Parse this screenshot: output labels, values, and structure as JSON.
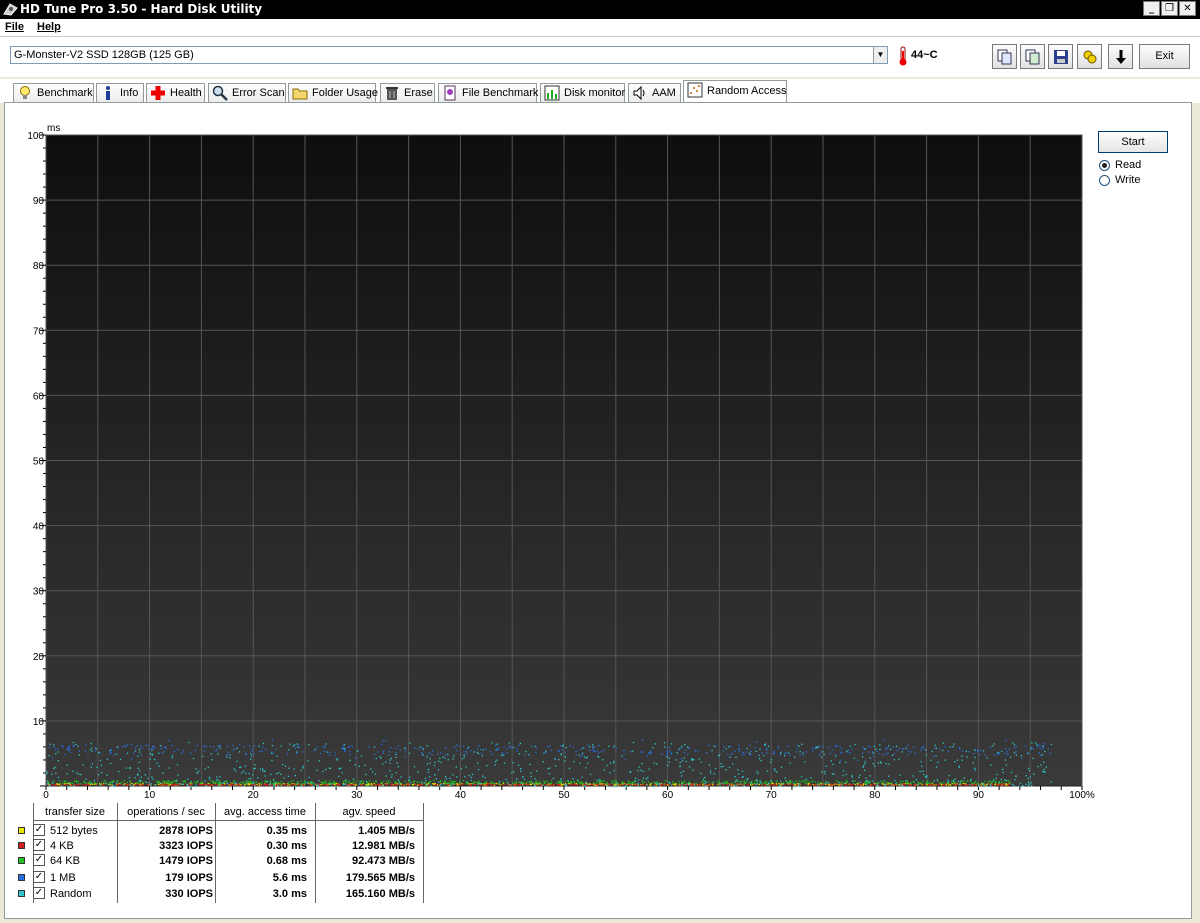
{
  "window": {
    "title": "HD Tune Pro 3.50 - Hard Disk Utility"
  },
  "menu": {
    "file": "File",
    "help": "Help"
  },
  "toolbar": {
    "drive": "G-Monster-V2 SSD 128GB (125 GB)",
    "temperature": "44~C",
    "exit_label": "Exit"
  },
  "tabs": [
    {
      "label": "Benchmark",
      "icon": "lightbulb-icon"
    },
    {
      "label": "Info",
      "icon": "info-icon"
    },
    {
      "label": "Health",
      "icon": "health-cross-icon"
    },
    {
      "label": "Error Scan",
      "icon": "magnifier-icon"
    },
    {
      "label": "Folder Usage",
      "icon": "folder-icon"
    },
    {
      "label": "Erase",
      "icon": "trash-icon"
    },
    {
      "label": "File Benchmark",
      "icon": "file-benchmark-icon"
    },
    {
      "label": "Disk monitor",
      "icon": "disk-monitor-icon"
    },
    {
      "label": "AAM",
      "icon": "speaker-icon"
    },
    {
      "label": "Random Access",
      "icon": "random-access-icon",
      "active": true
    }
  ],
  "controls": {
    "start_label": "Start",
    "read_label": "Read",
    "write_label": "Write",
    "selected": "Read"
  },
  "chart_data": {
    "type": "scatter",
    "ylabel": "ms",
    "ylim": [
      0,
      100
    ],
    "xlim": [
      0,
      100
    ],
    "yticks": [
      "10",
      "20",
      "30",
      "40",
      "50",
      "60",
      "70",
      "80",
      "90",
      "100"
    ],
    "xticks": [
      "0",
      "10",
      "20",
      "30",
      "40",
      "50",
      "60",
      "70",
      "80",
      "90",
      "100%"
    ],
    "grid": true,
    "series": [
      {
        "name": "512 bytes",
        "color": "#e0e000",
        "y_center": 0.35,
        "spread": 0.3,
        "x_max": 93
      },
      {
        "name": "4 KB",
        "color": "#d02020",
        "y_center": 0.3,
        "spread": 0.2,
        "x_max": 93
      },
      {
        "name": "64 KB",
        "color": "#20c020",
        "y_center": 0.68,
        "spread": 0.5,
        "x_max": 93
      },
      {
        "name": "1 MB",
        "color": "#2870e0",
        "y_center": 5.6,
        "spread": 1.6,
        "x_max": 97
      },
      {
        "name": "Random",
        "color": "#30c8c8",
        "y_center": 3.0,
        "spread": 3.0,
        "x_max": 97
      }
    ]
  },
  "results": {
    "headers": {
      "size": "transfer size",
      "ops": "operations / sec",
      "access": "avg. access time",
      "speed": "agv. speed"
    },
    "rows": [
      {
        "size": "512 bytes",
        "ops": "2878 IOPS",
        "access": "0.35 ms",
        "speed": "1.405 MB/s",
        "color": "#e8e800"
      },
      {
        "size": "4 KB",
        "ops": "3323 IOPS",
        "access": "0.30 ms",
        "speed": "12.981 MB/s",
        "color": "#d02020"
      },
      {
        "size": "64 KB",
        "ops": "1479 IOPS",
        "access": "0.68 ms",
        "speed": "92.473 MB/s",
        "color": "#20c020"
      },
      {
        "size": "1 MB",
        "ops": "179 IOPS",
        "access": "5.6 ms",
        "speed": "179.565 MB/s",
        "color": "#2870e0"
      },
      {
        "size": "Random",
        "ops": "330 IOPS",
        "access": "3.0 ms",
        "speed": "165.160 MB/s",
        "color": "#30c8c8"
      }
    ]
  }
}
